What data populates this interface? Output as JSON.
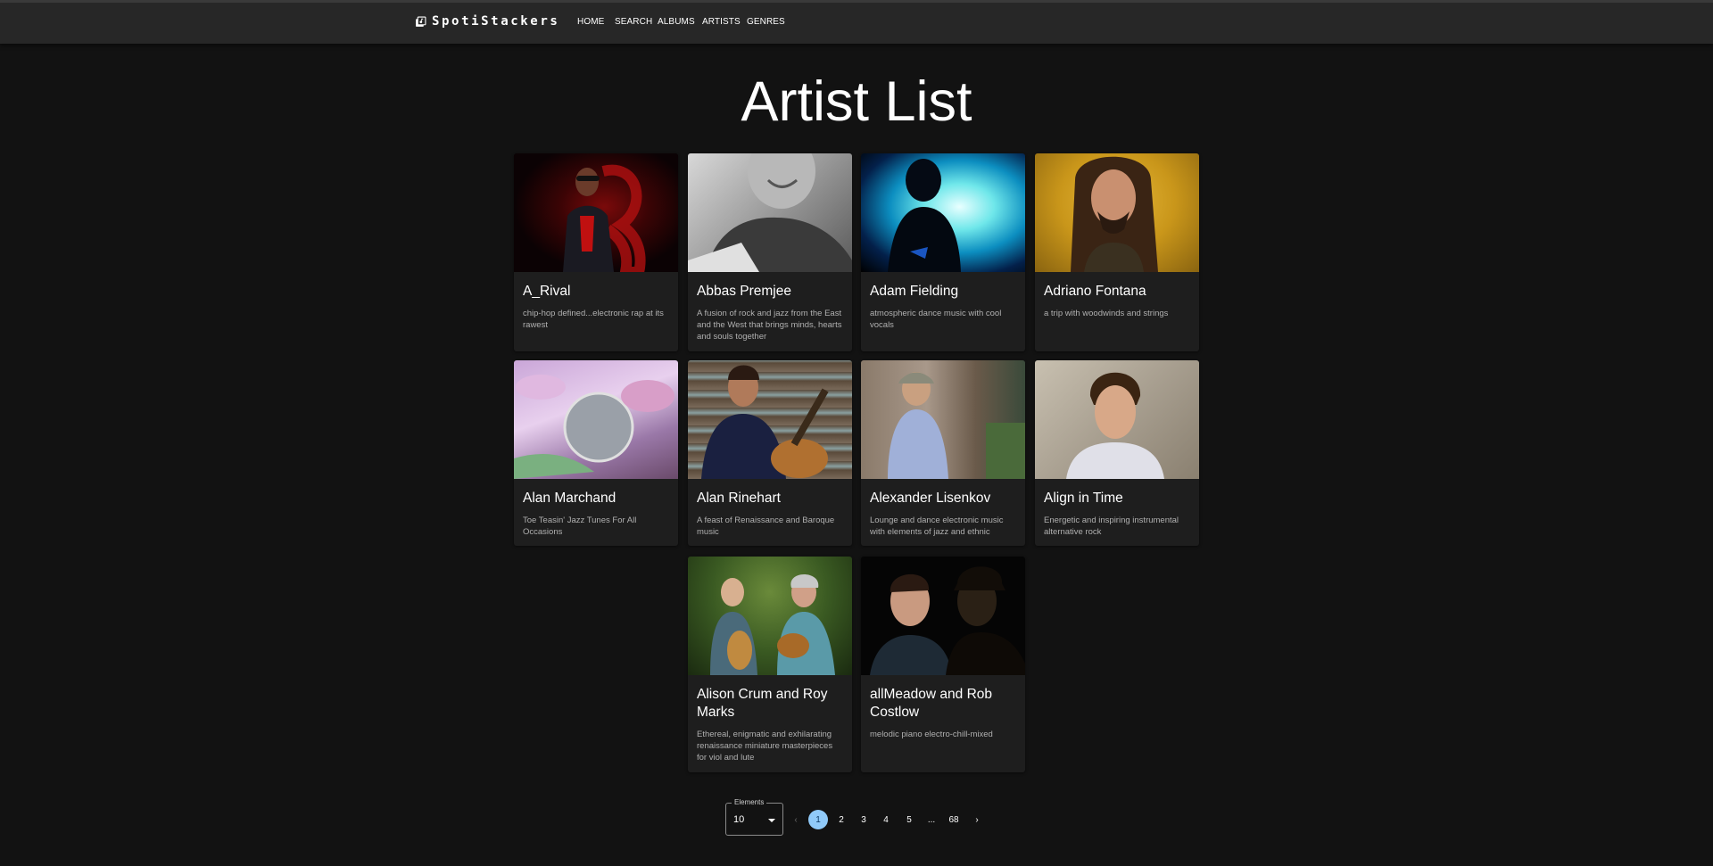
{
  "app": {
    "brand": "SpotiStackers",
    "nav": [
      "HOME",
      "SEARCH",
      "ALBUMS",
      "ARTISTS",
      "GENRES"
    ]
  },
  "page": {
    "title": "Artist List"
  },
  "artists": [
    {
      "name": "A_Rival",
      "description": "chip-hop defined...electronic rap at its rawest"
    },
    {
      "name": "Abbas Premjee",
      "description": "A fusion of rock and jazz from the East and the West that brings minds, hearts and souls together"
    },
    {
      "name": "Adam Fielding",
      "description": "atmospheric dance music with cool vocals"
    },
    {
      "name": "Adriano Fontana",
      "description": "a trip with woodwinds and strings"
    },
    {
      "name": "Alan Marchand",
      "description": "Toe Teasin' Jazz Tunes For All Occasions"
    },
    {
      "name": "Alan Rinehart",
      "description": "A feast of Renaissance and Baroque music"
    },
    {
      "name": "Alexander Lisenkov",
      "description": "Lounge and dance electronic music with elements of jazz and ethnic"
    },
    {
      "name": "Align in Time",
      "description": "Energetic and inspiring instrumental alternative rock"
    },
    {
      "name": "Alison Crum and Roy Marks",
      "description": "Ethereal, enigmatic and exhilarating renaissance miniature masterpieces for viol and lute"
    },
    {
      "name": "allMeadow and Rob Costlow",
      "description": "melodic piano electro-chill-mixed"
    }
  ],
  "pagination": {
    "elements_label": "Elements",
    "elements_value": "10",
    "prev": "‹",
    "next": "›",
    "pages": [
      "1",
      "2",
      "3",
      "4",
      "5"
    ],
    "ellipsis": "...",
    "last": "68",
    "current": "1"
  },
  "colors": {
    "background": "#121212",
    "appbar": "#272727",
    "card": "#1e1e1e",
    "active_page": "#90caf9"
  }
}
